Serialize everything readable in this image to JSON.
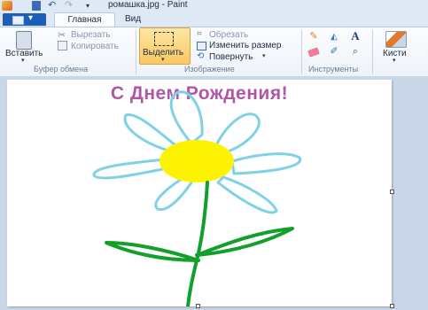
{
  "window": {
    "title": "ромашка.jpg - Paint"
  },
  "tabs": {
    "file": "▾",
    "home": "Главная",
    "view": "Вид"
  },
  "ribbon": {
    "clipboard": {
      "paste": "Вставить",
      "cut": "Вырезать",
      "copy": "Копировать",
      "label": "Буфер обмена"
    },
    "image": {
      "select": "Выделить",
      "crop": "Обрезать",
      "resize": "Изменить размер",
      "rotate": "Повернуть",
      "label": "Изображение"
    },
    "tools": {
      "label": "Инструменты"
    },
    "brushes": {
      "label": "Кисти"
    }
  },
  "canvas": {
    "greeting": "С Днем Рождения!"
  },
  "colors": {
    "greeting": "#b056a9",
    "petal": "#7fd2e6",
    "center": "#fdf200",
    "stem": "#12a02a"
  }
}
